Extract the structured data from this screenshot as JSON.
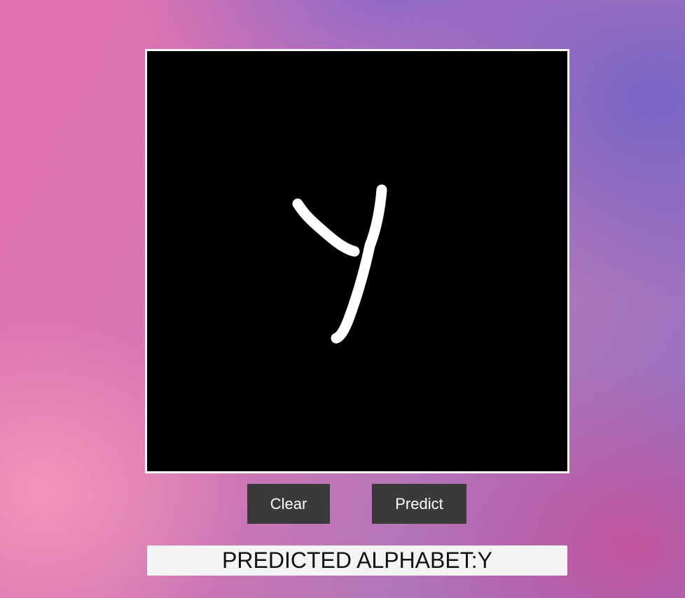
{
  "page": {
    "background_colors": [
      "#e56aae",
      "#8a6ac4",
      "#cd4696"
    ]
  },
  "drawing_canvas": {
    "background": "#000000",
    "border_color": "#ffffff",
    "stroke_color": "#ffffff"
  },
  "buttons": {
    "clear_label": "Clear",
    "predict_label": "Predict",
    "background": "#3a3a3a",
    "text_color": "#ffffff"
  },
  "result": {
    "text": "PREDICTED ALPHABET:Y"
  }
}
